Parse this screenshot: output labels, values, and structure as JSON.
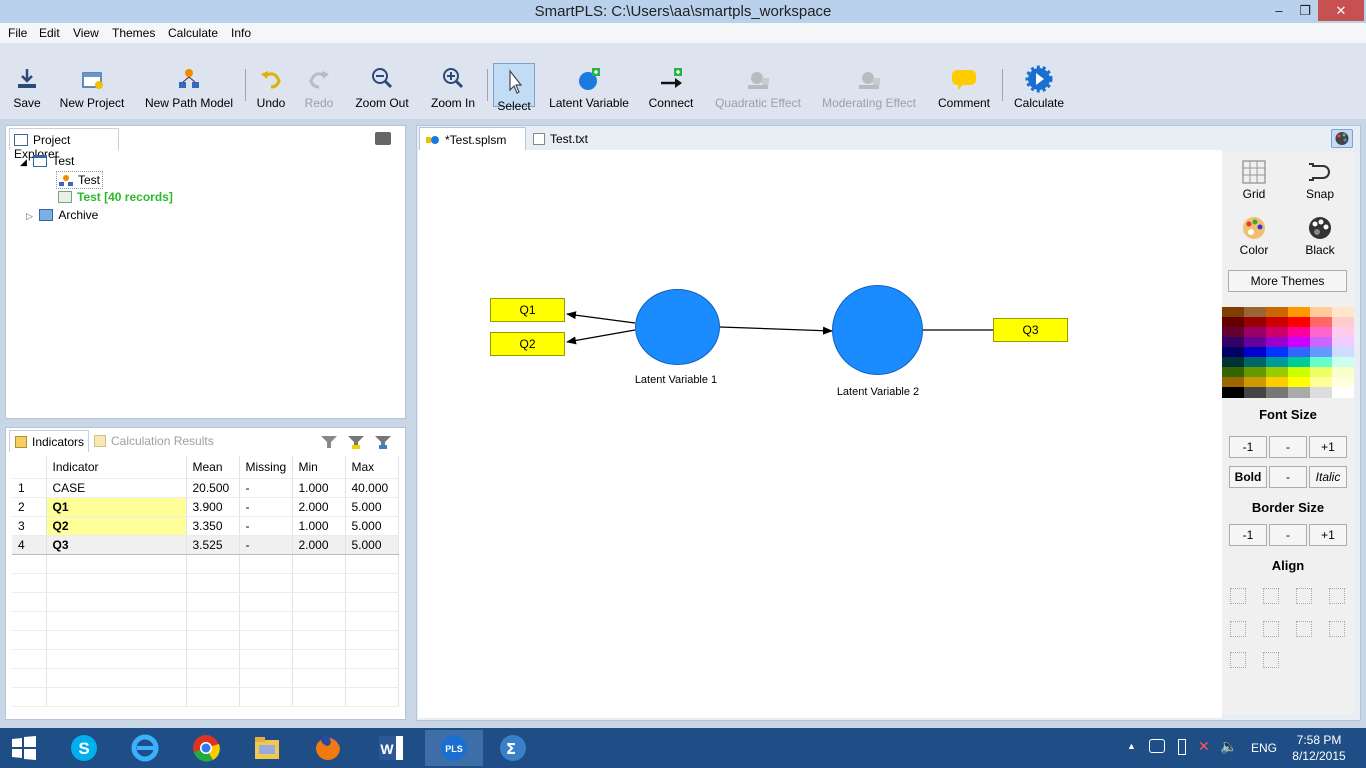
{
  "window": {
    "title": "SmartPLS: C:\\Users\\aa\\smartpls_workspace"
  },
  "menu": [
    "File",
    "Edit",
    "View",
    "Themes",
    "Calculate",
    "Info"
  ],
  "toolbar": {
    "save": "Save",
    "new_project": "New Project",
    "new_path_model": "New Path Model",
    "undo": "Undo",
    "redo": "Redo",
    "zoom_out": "Zoom Out",
    "zoom_in": "Zoom In",
    "select": "Select",
    "latent_variable": "Latent Variable",
    "connect": "Connect",
    "quadratic_effect": "Quadratic Effect",
    "moderating_effect": "Moderating Effect",
    "comment": "Comment",
    "calculate": "Calculate"
  },
  "project_explorer": {
    "tab": "Project Explorer",
    "items": [
      {
        "label": "Test"
      },
      {
        "label": "Test"
      },
      {
        "label": "Test [40 records]"
      },
      {
        "label": "Archive"
      }
    ]
  },
  "indicators_panel": {
    "tabs": [
      "Indicators",
      "Calculation Results"
    ],
    "columns": [
      "",
      "Indicator",
      "Mean",
      "Missing",
      "Min",
      "Max"
    ],
    "rows": [
      {
        "n": "1",
        "name": "CASE",
        "mean": "20.500",
        "missing": "-",
        "min": "1.000",
        "max": "40.000"
      },
      {
        "n": "2",
        "name": "Q1",
        "mean": "3.900",
        "missing": "-",
        "min": "2.000",
        "max": "5.000"
      },
      {
        "n": "3",
        "name": "Q2",
        "mean": "3.350",
        "missing": "-",
        "min": "1.000",
        "max": "5.000"
      },
      {
        "n": "4",
        "name": "Q3",
        "mean": "3.525",
        "missing": "-",
        "min": "2.000",
        "max": "5.000"
      }
    ]
  },
  "editor_tabs": [
    "*Test.splsm",
    "Test.txt"
  ],
  "model": {
    "indicators": [
      "Q1",
      "Q2",
      "Q3"
    ],
    "latent_variables": [
      "Latent Variable 1",
      "Latent Variable 2"
    ]
  },
  "side_panel": {
    "grid": "Grid",
    "snap": "Snap",
    "color": "Color",
    "black": "Black",
    "more_themes": "More Themes",
    "font_size": "Font Size",
    "minus1": "-1",
    "dash": "-",
    "plus1": "+1",
    "bold": "Bold",
    "italic": "Italic",
    "border_size": "Border Size",
    "align": "Align",
    "palette_colors": [
      [
        "#7f3f00",
        "#996633",
        "#cc6600",
        "#ff9900",
        "#ffcc99",
        "#ffe5cc"
      ],
      [
        "#660000",
        "#990000",
        "#cc0000",
        "#ff0000",
        "#ff6666",
        "#ffcccc"
      ],
      [
        "#660033",
        "#990066",
        "#cc0066",
        "#ff0099",
        "#ff66cc",
        "#ffccee"
      ],
      [
        "#330066",
        "#660099",
        "#9900cc",
        "#cc00ff",
        "#cc66ff",
        "#eeccff"
      ],
      [
        "#000066",
        "#0000cc",
        "#0033ff",
        "#3366ff",
        "#6699ff",
        "#ccddff"
      ],
      [
        "#003333",
        "#006666",
        "#009999",
        "#00cc99",
        "#66ffcc",
        "#ccffee"
      ],
      [
        "#336600",
        "#669900",
        "#99cc00",
        "#ccff00",
        "#eeff66",
        "#f8ffcc"
      ],
      [
        "#996600",
        "#cc9900",
        "#ffcc00",
        "#ffff00",
        "#ffff99",
        "#ffffdd"
      ],
      [
        "#000000",
        "#444444",
        "#777777",
        "#aaaaaa",
        "#dddddd",
        "#ffffff"
      ]
    ]
  },
  "tray": {
    "lang": "ENG",
    "time": "7:58 PM",
    "date": "8/12/2015"
  }
}
